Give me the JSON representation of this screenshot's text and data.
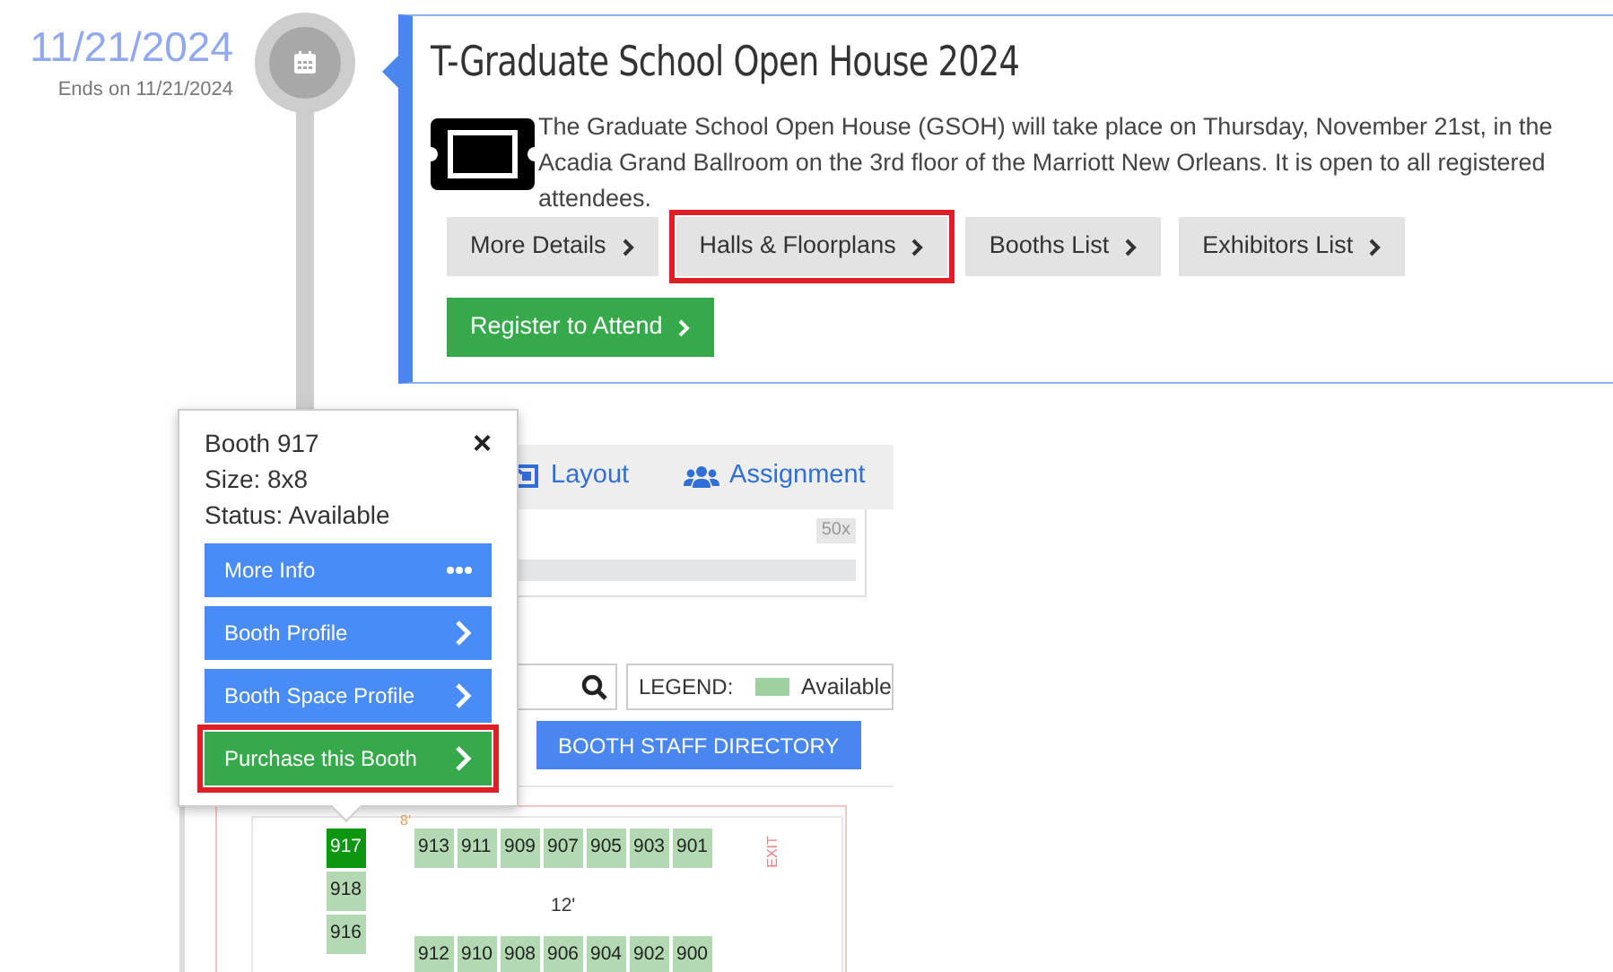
{
  "timeline": {
    "date": "11/21/2024",
    "ends": "Ends on 11/21/2024"
  },
  "event": {
    "title": "T-Graduate School Open House 2024",
    "description": "The Graduate School Open House (GSOH) will take place on Thursday, November 21st, in the Acadia Grand Ballroom on the 3rd floor of the Marriott New Orleans. It is open to all registered attendees.",
    "buttons": [
      {
        "label": "More Details",
        "kind": "secondary",
        "highlighted": false
      },
      {
        "label": "Halls & Floorplans",
        "kind": "secondary",
        "highlighted": true
      },
      {
        "label": "Booths List",
        "kind": "secondary",
        "highlighted": false
      },
      {
        "label": "Exhibitors List",
        "kind": "secondary",
        "highlighted": false
      },
      {
        "label": "Register to Attend",
        "kind": "primary",
        "highlighted": false
      }
    ]
  },
  "floorplan": {
    "tabs": [
      {
        "label": "Layout",
        "kind": "layout"
      },
      {
        "label": "Assignment",
        "kind": "users"
      }
    ],
    "zoom": "50x",
    "legend_label": "LEGEND:",
    "legend_items": [
      {
        "label": "Available",
        "color": "#9fd09f"
      }
    ],
    "buttons": [
      "BOOTH STAFF DIRECTORY"
    ],
    "labels": {
      "side_gap": "8'",
      "aisle": "12'",
      "exit": "EXIT"
    },
    "column": [
      {
        "number": "917",
        "selected": true
      },
      {
        "number": "918",
        "selected": false
      },
      {
        "number": "916",
        "selected": false
      }
    ],
    "top_row": [
      {
        "number": "913",
        "selected": false
      },
      {
        "number": "911",
        "selected": false
      },
      {
        "number": "909",
        "selected": false
      },
      {
        "number": "907",
        "selected": false
      },
      {
        "number": "905",
        "selected": false
      },
      {
        "number": "903",
        "selected": false
      },
      {
        "number": "901",
        "selected": false
      }
    ],
    "bottom_row": [
      {
        "number": "912",
        "selected": false
      },
      {
        "number": "910",
        "selected": false
      },
      {
        "number": "908",
        "selected": false
      },
      {
        "number": "906",
        "selected": false
      },
      {
        "number": "904",
        "selected": false
      },
      {
        "number": "902",
        "selected": false
      },
      {
        "number": "900",
        "selected": false
      }
    ]
  },
  "popup": {
    "title": "Booth 917",
    "close": "×",
    "size": "Size: 8x8",
    "status": "Status: Available",
    "actions": [
      {
        "label": "More Info",
        "kind": "more",
        "highlighted": false
      },
      {
        "label": "Booth Profile",
        "kind": "link",
        "highlighted": false
      },
      {
        "label": "Booth Space Profile",
        "kind": "link",
        "highlighted": false
      },
      {
        "label": "Purchase this Booth",
        "kind": "purchase",
        "highlighted": true
      }
    ]
  }
}
